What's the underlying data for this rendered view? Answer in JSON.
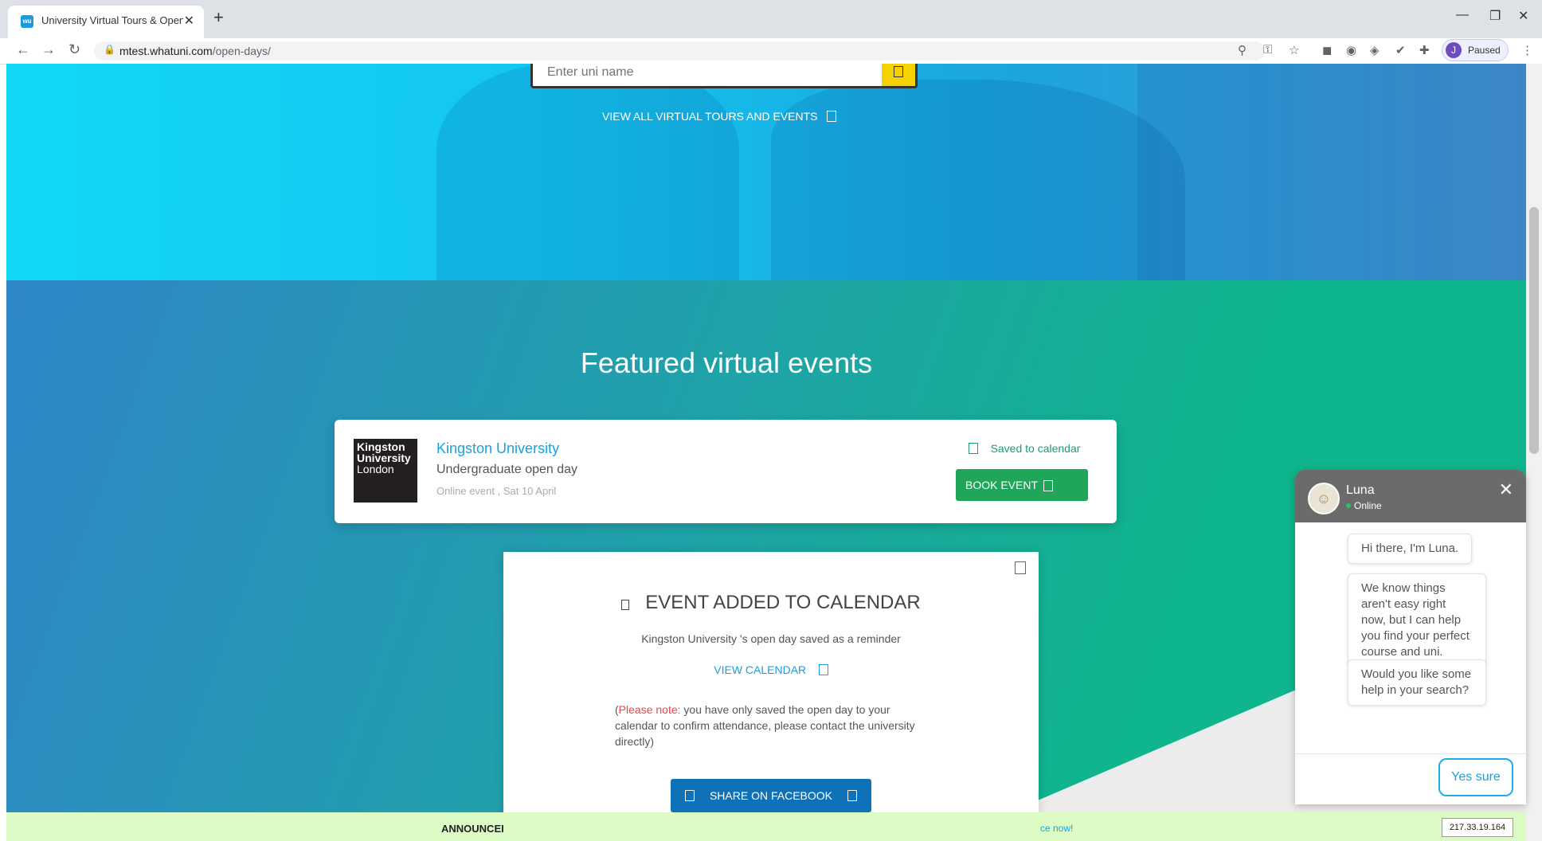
{
  "browser": {
    "tab_title": "University Virtual Tours & Open Days",
    "url_host": "mtest.whatuni.com",
    "url_path": "/open-days/",
    "profile_initial": "J",
    "profile_label": "Paused"
  },
  "hero": {
    "search_placeholder": "Enter uni name",
    "view_all_label": "VIEW ALL VIRTUAL TOURS AND EVENTS"
  },
  "featured": {
    "heading": "Featured virtual events",
    "event": {
      "logo_lines": [
        "Kingston",
        "University",
        "London"
      ],
      "university": "Kingston University",
      "type": "Undergraduate open day",
      "meta": "Online event , Sat 10 April",
      "saved_label": "Saved to calendar",
      "book_label": "BOOK EVENT"
    }
  },
  "modal": {
    "title": "EVENT ADDED TO CALENDAR",
    "subtitle": "Kingston University 's open day saved as a reminder",
    "view_calendar": "VIEW CALENDAR",
    "note_prefix": "(",
    "note_label": "Please note:",
    "note_text": " you have only saved the open day to your calendar to confirm attendance, please contact the university directly)",
    "share_label": "SHARE ON FACEBOOK"
  },
  "announcement": {
    "label": "ANNOUNCEI",
    "link": "ce now!"
  },
  "ip_label": "217.33.19.164",
  "chat": {
    "name": "Luna",
    "status": "Online",
    "messages": [
      "Hi there, I'm Luna.",
      "We know things aren't easy right now, but I can help you find your perfect course and uni.",
      "Would you like some help in your search?"
    ],
    "reply": "Yes sure"
  },
  "colors": {
    "accent": "#1aa0df",
    "book_button": "#20a65a",
    "share_button": "#0f72b8",
    "search_button": "#f5d300"
  }
}
